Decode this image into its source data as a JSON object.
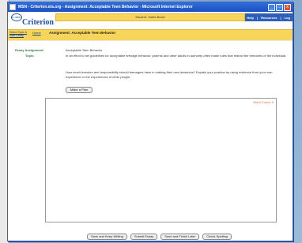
{
  "window": {
    "title": "MSN - Criterion.ets.org - Assignment: Acceptable Teen Behavior - Microsoft Internet Explorer",
    "min_label": "_",
    "max_label": "□",
    "close_label": "x"
  },
  "header": {
    "logo_badge": "e-rater",
    "logo_text": "Criterion",
    "student_label": "Student: Vadra Bowe",
    "links": [
      "Help",
      "Resources",
      "Log"
    ]
  },
  "nav": {
    "back_link": "Select Topic & Start Essay",
    "home_link": "Home",
    "assignment_title": "Assignment: Acceptable Teen Behavior"
  },
  "assignment": {
    "essay_label": "Essay Assignment:",
    "essay_value": "Acceptable Teen Behavior",
    "topic_label": "Topic:",
    "topic_text_1": "In an effort to set guidelines for acceptable teenage behavior, parents and other adults in authority often make rules that restrict the freedoms of the individual.",
    "topic_text_2": "How much freedom and responsibility should teenagers have in making their own decisions? Explain your position by using evidence from your own experience or the experiences of other people.",
    "make_plan_button": "Make a Plan"
  },
  "editor": {
    "word_count": "Word Count: 0"
  },
  "actions": {
    "save_keep": "Save and Keep Writing",
    "submit": "Submit Essay",
    "save_finish": "Save and Finish Later",
    "spelling": "Check Spelling"
  }
}
